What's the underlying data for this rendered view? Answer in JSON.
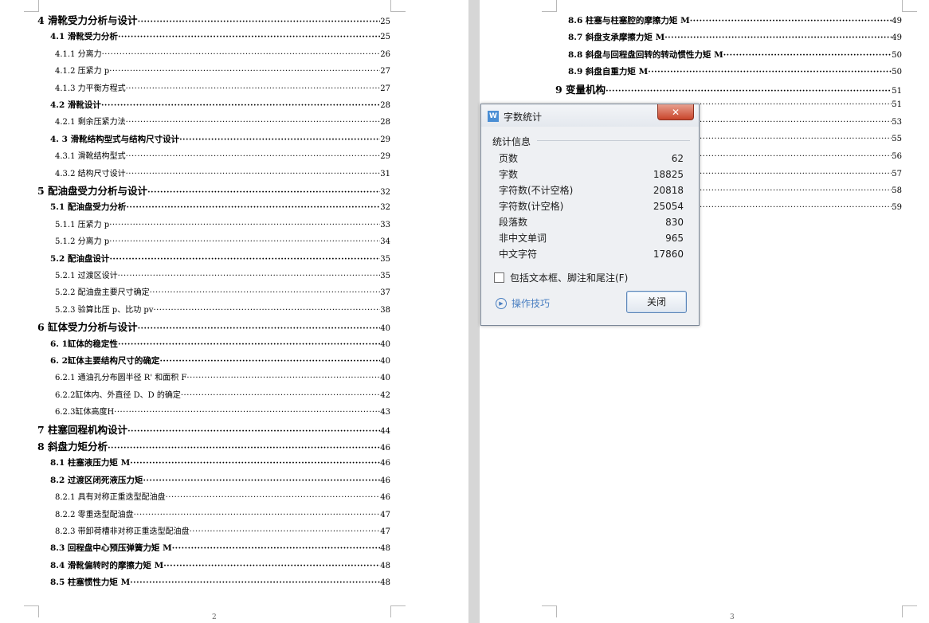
{
  "left_page": {
    "entries": [
      {
        "title": "4 滑靴受力分析与设计",
        "page": "25",
        "level": 1
      },
      {
        "title": "4.1 滑靴受力分析",
        "page": "25",
        "level": 2
      },
      {
        "title": "4.1.1 分离力",
        "page": "26",
        "level": 3
      },
      {
        "title": "4.1.2 压紧力 p",
        "page": "27",
        "level": 3
      },
      {
        "title": "4.1.3 力平衡方程式",
        "page": "27",
        "level": 3
      },
      {
        "title": "4.2 滑靴设计",
        "page": "28",
        "level": 2
      },
      {
        "title": "4.2.1 剩余压紧力法",
        "page": "28",
        "level": 3
      },
      {
        "title": "4. 3 滑靴结构型式与结构尺寸设计",
        "page": "29",
        "level": 2
      },
      {
        "title": "4.3.1 滑靴结构型式",
        "page": "29",
        "level": 3
      },
      {
        "title": "4.3.2 结构尺寸设计",
        "page": "31",
        "level": 3
      },
      {
        "title": "5  配油盘受力分析与设计",
        "page": "32",
        "level": 1
      },
      {
        "title": "5.1 配油盘受力分析",
        "page": "32",
        "level": 2
      },
      {
        "title": "5.1.1 压紧力 p",
        "page": "33",
        "level": 3
      },
      {
        "title": "5.1.2 分离力 p",
        "page": "34",
        "level": 3
      },
      {
        "title": "5.2 配油盘设计",
        "page": "35",
        "level": 2
      },
      {
        "title": "5.2.1 过渡区设计",
        "page": "35",
        "level": 3
      },
      {
        "title": "5.2.2 配油盘主要尺寸确定",
        "page": "37",
        "level": 3
      },
      {
        "title": "5.2.3 验算比压 p、比功 pv",
        "page": "38",
        "level": 3
      },
      {
        "title": "6  缸体受力分析与设计",
        "page": "40",
        "level": 1
      },
      {
        "title": "6. 1缸体的稳定性",
        "page": "40",
        "level": 2
      },
      {
        "title": "6. 2缸体主要结构尺寸的确定",
        "page": "40",
        "level": 2
      },
      {
        "title": "6.2.1 通油孔分布圆半径 R' 和面积 F",
        "page": "40",
        "level": 3
      },
      {
        "title": "6.2.2缸体内、外直径 D、D 的确定",
        "page": "42",
        "level": 3
      },
      {
        "title": "6.2.3缸体高度H",
        "page": "43",
        "level": 3
      },
      {
        "title": "7 柱塞回程机构设计",
        "page": "44",
        "level": 1
      },
      {
        "title": "8  斜盘力矩分析",
        "page": "46",
        "level": 1
      },
      {
        "title": "8.1 柱塞液压力矩 M",
        "page": "46",
        "level": 2
      },
      {
        "title": "8.2 过渡区闭死液压力矩",
        "page": "46",
        "level": 2
      },
      {
        "title": "8.2.1 具有对称正重迭型配油盘",
        "page": "46",
        "level": 3
      },
      {
        "title": "8.2.2 零重迭型配油盘",
        "page": "47",
        "level": 3
      },
      {
        "title": "8.2.3 带卸荷槽非对称正重迭型配油盘",
        "page": "47",
        "level": 3
      },
      {
        "title": "8.3 回程盘中心预压弹簧力矩 M",
        "page": "48",
        "level": 2
      },
      {
        "title": "8.4 滑靴偏转时的摩擦力矩 M",
        "page": "48",
        "level": 2
      },
      {
        "title": "8.5 柱塞惯性力矩 M",
        "page": "48",
        "level": 2
      }
    ],
    "page_number": "2"
  },
  "right_page": {
    "entries": [
      {
        "title": "8.6 柱塞与柱塞腔的摩擦力矩 M",
        "page": "49",
        "level": 2
      },
      {
        "title": "8.7 斜盘支承摩擦力矩 M",
        "page": "49",
        "level": 2
      },
      {
        "title": "8.8 斜盘与回程盘回转的转动惯性力矩 M",
        "page": "50",
        "level": 2
      },
      {
        "title": "8.9 斜盘自重力矩 M",
        "page": "50",
        "level": 2
      },
      {
        "title": "9  变量机构",
        "page": "51",
        "level": 1
      }
    ],
    "hidden_pages": [
      "51",
      "53",
      "55",
      "56",
      "57",
      "58",
      "59"
    ],
    "page_number": "3"
  },
  "dialog": {
    "title": "字数统计",
    "close_glyph": "✕",
    "app_icon": "W",
    "group_label": "统计信息",
    "stats": [
      {
        "label": "页数",
        "value": "62"
      },
      {
        "label": "字数",
        "value": "18825"
      },
      {
        "label": "字符数(不计空格)",
        "value": "20818"
      },
      {
        "label": "字符数(计空格)",
        "value": "25054"
      },
      {
        "label": "段落数",
        "value": "830"
      },
      {
        "label": "非中文单词",
        "value": "965"
      },
      {
        "label": "中文字符",
        "value": "17860"
      }
    ],
    "checkbox_label": "包括文本框、脚注和尾注(F)",
    "tips_label": "操作技巧",
    "ok_label": "关闭"
  }
}
